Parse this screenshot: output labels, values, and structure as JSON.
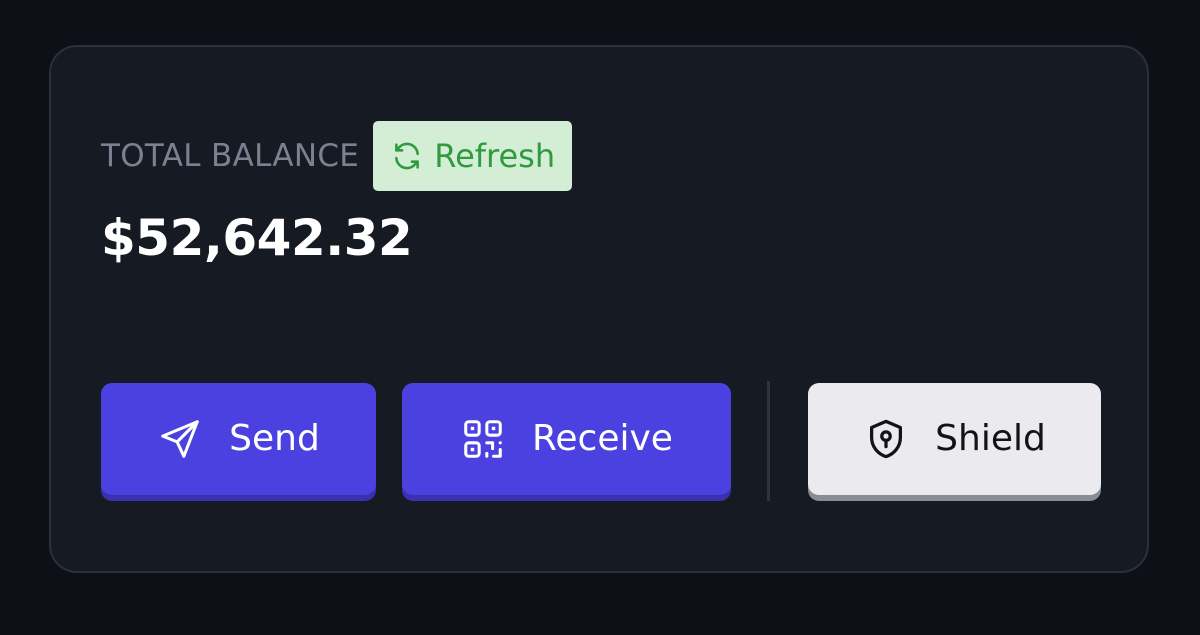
{
  "balance": {
    "label": "TOTAL BALANCE",
    "refresh_label": "Refresh",
    "amount": "$52,642.32"
  },
  "actions": {
    "send_label": "Send",
    "receive_label": "Receive",
    "shield_label": "Shield"
  },
  "icons": {
    "refresh": "refresh-icon",
    "send": "paper-plane-icon",
    "receive": "qr-code-icon",
    "shield": "shield-keyhole-icon"
  },
  "colors": {
    "background": "#0d1017",
    "card": "#161a23",
    "primary": "#4b40e0",
    "refresh_bg": "#d4eed6",
    "refresh_text": "#2f9a3f",
    "secondary": "#ebebef"
  }
}
